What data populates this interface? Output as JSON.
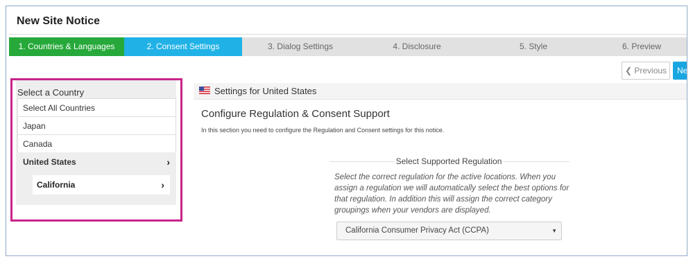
{
  "header": {
    "title": "New Site Notice"
  },
  "steps": [
    {
      "label": "1. Countries & Languages",
      "state": "done"
    },
    {
      "label": "2. Consent Settings",
      "state": "active"
    },
    {
      "label": "3. Dialog Settings",
      "state": "pending"
    },
    {
      "label": "4. Disclosure",
      "state": "pending"
    },
    {
      "label": "5. Style",
      "state": "pending"
    },
    {
      "label": "6. Preview",
      "state": "pending"
    }
  ],
  "nav": {
    "previous_label": "Previous",
    "next_label": "Next"
  },
  "country_panel": {
    "title": "Select a Country",
    "items": [
      {
        "label": "Select All Countries"
      },
      {
        "label": "Japan"
      },
      {
        "label": "Canada"
      },
      {
        "label": "United States"
      }
    ],
    "sub_item": "California"
  },
  "settings": {
    "header": "Settings for United States",
    "section_title": "Configure Regulation & Consent Support",
    "section_desc": "In this section you need to configure the Regulation and Consent settings for this notice.",
    "regulation_label": "Select Supported Regulation",
    "regulation_desc": "Select the correct regulation for the active locations. When you assign a regulation we will automatically select the best options for that regulation. In addition this will assign the correct category groupings when your vendors are displayed.",
    "regulation_value": "California Consumer Privacy Act (CCPA)"
  },
  "colors": {
    "step_done": "#26a93a",
    "step_active": "#20b2e6",
    "highlight": "#c8238a",
    "next_button": "#1aa6e0"
  }
}
